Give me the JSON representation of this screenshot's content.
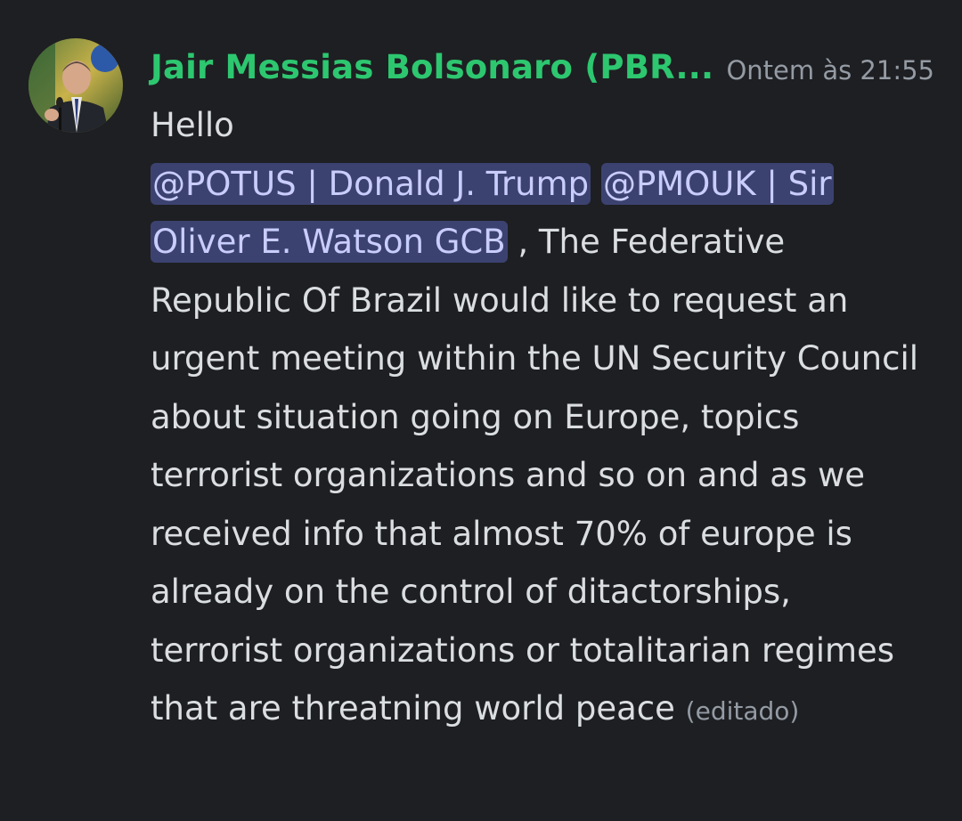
{
  "message": {
    "author": "Jair Messias Bolsonaro (PBR...",
    "timestamp": "Ontem às 21:55",
    "greeting": "Hello",
    "mentions": [
      "@POTUS | Donald J. Trump",
      "@PMOUK | Sir Oliver E. Watson GCB"
    ],
    "separator": " ",
    "body": ", The Federative Republic Of Brazil would like to request an urgent meeting within the UN Security Council about situation going on Europe, topics terrorist organizations and so on and as we received info that almost 70% of europe is already on the control of ditactorships, terrorist organizations or totalitarian regimes that are threatning world peace",
    "edited_label": "(editado)"
  },
  "colors": {
    "background": "#1e1f22",
    "username": "#2dc770",
    "mention_bg": "#3c4270",
    "mention_text": "#c9cdfb",
    "muted": "#949ba4",
    "text": "#dbdee1"
  },
  "icons": {
    "avatar": "user-avatar-photo"
  }
}
